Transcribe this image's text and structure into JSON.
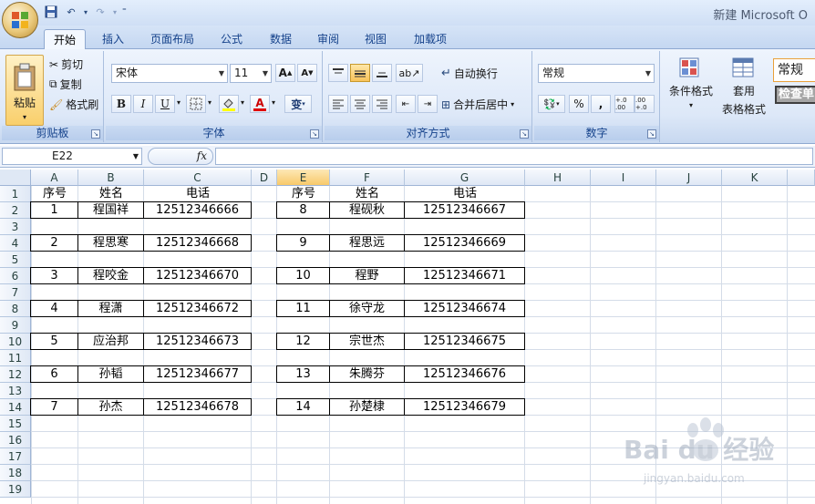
{
  "window": {
    "title": "新建 Microsoft O"
  },
  "ribbon_tabs": [
    {
      "label": "开始",
      "active": true
    },
    {
      "label": "插入"
    },
    {
      "label": "页面布局"
    },
    {
      "label": "公式"
    },
    {
      "label": "数据"
    },
    {
      "label": "审阅"
    },
    {
      "label": "视图"
    },
    {
      "label": "加载项"
    }
  ],
  "clipboard": {
    "paste_label": "粘贴",
    "cut_label": "剪切",
    "copy_label": "复制",
    "format_painter_label": "格式刷",
    "group_label": "剪贴板"
  },
  "font": {
    "font_name": "宋体",
    "font_size": "11",
    "grow_label": "A",
    "shrink_label": "A",
    "bold": "B",
    "italic": "I",
    "underline": "U",
    "font_color_glyph": "A",
    "phonetic_glyph": "变",
    "group_label": "字体"
  },
  "alignment": {
    "wrap_label": "自动换行",
    "merge_label": "合并后居中",
    "group_label": "对齐方式"
  },
  "number": {
    "format": "常规",
    "percent": "%",
    "comma": ",",
    "increase_decimal": "+.0 .00",
    "decrease_decimal": ".00 +.0",
    "group_label": "数字"
  },
  "styles": {
    "conditional_label": "条件格式",
    "table_label_1": "套用",
    "table_label_2": "表格格式",
    "style_normal": "常规",
    "style_check": "检查单"
  },
  "formula_bar": {
    "name_box": "E22",
    "fx_label": "fx"
  },
  "sheet": {
    "columns": [
      "A",
      "B",
      "C",
      "D",
      "E",
      "F",
      "G",
      "H",
      "I",
      "J",
      "K"
    ],
    "selected_column": "E",
    "rows": [
      "1",
      "2",
      "3",
      "4",
      "5",
      "6",
      "7",
      "8",
      "9",
      "10",
      "11",
      "12",
      "13",
      "14",
      "15",
      "16",
      "17",
      "18",
      "19"
    ],
    "left_table": {
      "headers": [
        "序号",
        "姓名",
        "电话"
      ],
      "records": [
        {
          "row": 2,
          "values": [
            "1",
            "程国祥",
            "12512346666"
          ]
        },
        {
          "row": 4,
          "values": [
            "2",
            "程思寒",
            "12512346668"
          ]
        },
        {
          "row": 6,
          "values": [
            "3",
            "程咬金",
            "12512346670"
          ]
        },
        {
          "row": 8,
          "values": [
            "4",
            "程潇",
            "12512346672"
          ]
        },
        {
          "row": 10,
          "values": [
            "5",
            "应治邦",
            "12512346673"
          ]
        },
        {
          "row": 12,
          "values": [
            "6",
            "孙韬",
            "12512346677"
          ]
        },
        {
          "row": 14,
          "values": [
            "7",
            "孙杰",
            "12512346678"
          ]
        }
      ]
    },
    "right_table": {
      "headers": [
        "序号",
        "姓名",
        "电话"
      ],
      "records": [
        {
          "row": 2,
          "values": [
            "8",
            "程砚秋",
            "12512346667"
          ]
        },
        {
          "row": 4,
          "values": [
            "9",
            "程思远",
            "12512346669"
          ]
        },
        {
          "row": 6,
          "values": [
            "10",
            "程野",
            "12512346671"
          ]
        },
        {
          "row": 8,
          "values": [
            "11",
            "徐守龙",
            "12512346674"
          ]
        },
        {
          "row": 10,
          "values": [
            "12",
            "宗世杰",
            "12512346675"
          ]
        },
        {
          "row": 12,
          "values": [
            "13",
            "朱腾芬",
            "12512346676"
          ]
        },
        {
          "row": 14,
          "values": [
            "14",
            "孙楚棣",
            "12512346679"
          ]
        }
      ]
    }
  },
  "watermark": {
    "text": "Bai du 经验",
    "url_text": "jingyan.baidu.com"
  }
}
